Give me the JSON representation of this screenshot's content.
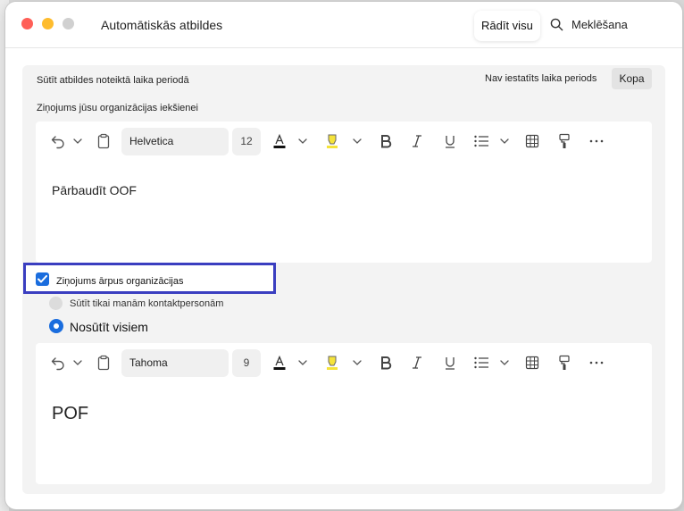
{
  "window": {
    "title": "Automātiskās atbildes",
    "show_all": "Rādīt visu",
    "search_label": "Meklēšana"
  },
  "schedule": {
    "label": "Sūtīt atbildes noteiktā laika periodā",
    "status": "Nav iestatīts laika periods",
    "button": "Kopa"
  },
  "inside": {
    "label": "Ziņojums jūsu organizācijas iekšienei",
    "toolbar": {
      "font": "Helvetica",
      "size": "12"
    },
    "body_text": "Pārbaudīt OOF"
  },
  "outside": {
    "checkbox_label": "Ziņojums ārpus organizācijas",
    "checked": true,
    "radio_contacts": "Sūtīt tikai manām kontaktpersonām",
    "radio_all": "Nosūtīt visiem",
    "selected": "radio_all",
    "toolbar": {
      "font": "Tahoma",
      "size": "9"
    },
    "body_text": "POF"
  },
  "colors": {
    "accent": "#1a6dde",
    "highlight_frame": "#3a3ec0",
    "highlighter_yellow": "#f5e33a"
  }
}
